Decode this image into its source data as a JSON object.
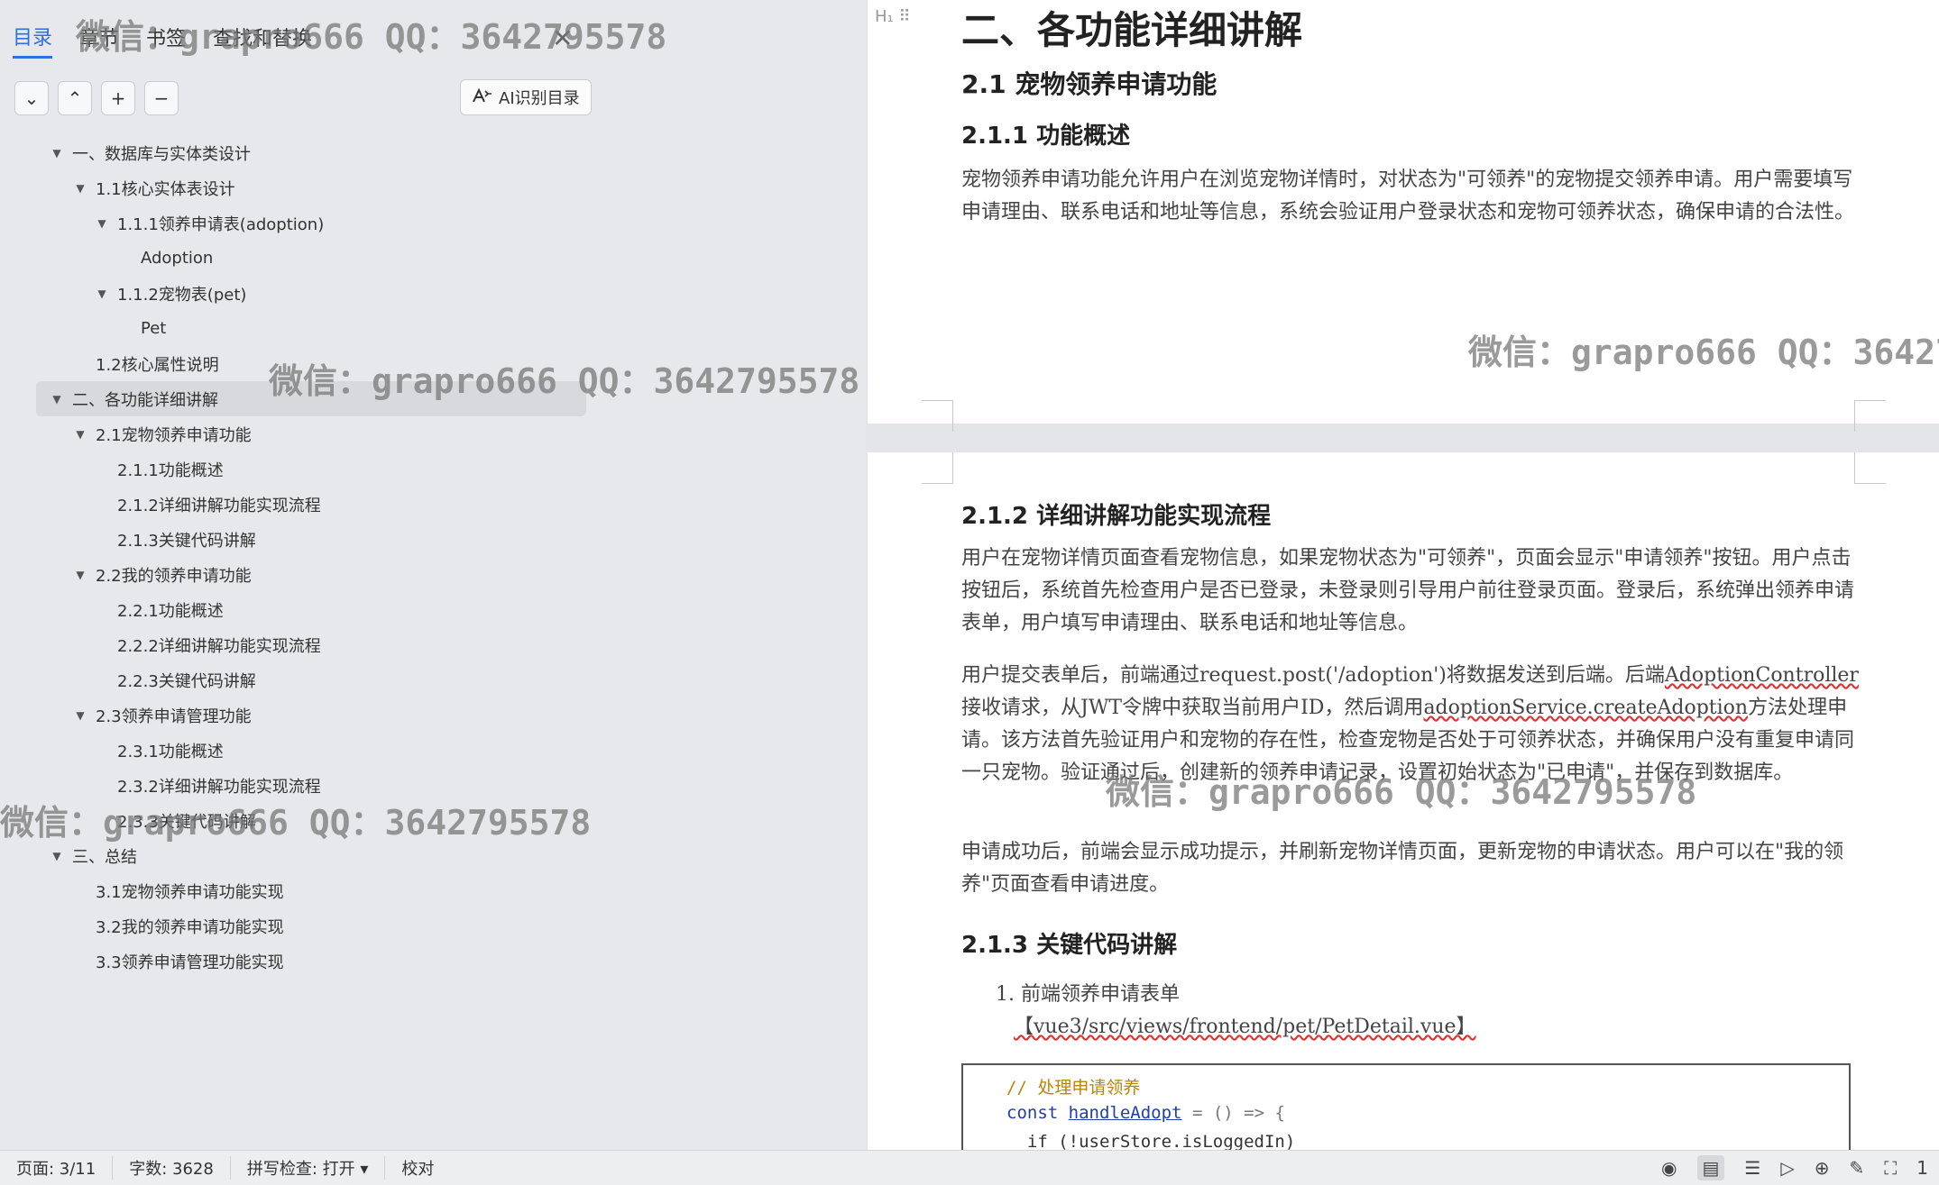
{
  "nav": {
    "tabs": [
      "目录",
      "章节",
      "书签",
      "查找和替换"
    ],
    "tools": [
      "chevron-down-icon",
      "chevron-up-icon",
      "plus-icon",
      "minus-icon"
    ],
    "ai_toc_label": "AI识别目录",
    "toc": [
      {
        "text": "一、数据库与实体类设计",
        "level": 1,
        "expanded": true
      },
      {
        "text": "1.1核心实体表设计",
        "level": 2,
        "expanded": true
      },
      {
        "text": "1.1.1领养申请表(adoption)",
        "level": 3,
        "expanded": true
      },
      {
        "text": "Adoption",
        "level": 4,
        "expanded": null
      },
      {
        "text": "1.1.2宠物表(pet)",
        "level": 3,
        "expanded": true
      },
      {
        "text": "Pet",
        "level": 4,
        "expanded": null
      },
      {
        "text": "1.2核心属性说明",
        "level": 2,
        "expanded": null
      },
      {
        "text": "二、各功能详细讲解",
        "level": 1,
        "expanded": true,
        "selected": true
      },
      {
        "text": "2.1宠物领养申请功能",
        "level": 2,
        "expanded": true
      },
      {
        "text": "2.1.1功能概述",
        "level": 3,
        "expanded": null
      },
      {
        "text": "2.1.2详细讲解功能实现流程",
        "level": 3,
        "expanded": null
      },
      {
        "text": "2.1.3关键代码讲解",
        "level": 3,
        "expanded": null
      },
      {
        "text": "2.2我的领养申请功能",
        "level": 2,
        "expanded": true
      },
      {
        "text": "2.2.1功能概述",
        "level": 3,
        "expanded": null
      },
      {
        "text": "2.2.2详细讲解功能实现流程",
        "level": 3,
        "expanded": null
      },
      {
        "text": "2.2.3关键代码讲解",
        "level": 3,
        "expanded": null
      },
      {
        "text": "2.3领养申请管理功能",
        "level": 2,
        "expanded": true
      },
      {
        "text": "2.3.1功能概述",
        "level": 3,
        "expanded": null
      },
      {
        "text": "2.3.2详细讲解功能实现流程",
        "level": 3,
        "expanded": null
      },
      {
        "text": "2.3.3关键代码讲解",
        "level": 3,
        "expanded": null
      },
      {
        "text": "三、总结",
        "level": 1,
        "expanded": true
      },
      {
        "text": "3.1宠物领养申请功能实现",
        "level": 2,
        "expanded": null
      },
      {
        "text": "3.2我的领养申请功能实现",
        "level": 2,
        "expanded": null
      },
      {
        "text": "3.3领养申请管理功能实现",
        "level": 2,
        "expanded": null
      }
    ]
  },
  "watermark": "微信：grapro666 QQ：3642795578",
  "doc": {
    "page1": {
      "h1": "二、各功能详细讲解",
      "h2": "2.1  宠物领养申请功能",
      "h3": "2.1.1  功能概述",
      "p1": "宠物领养申请功能允许用户在浏览宠物详情时，对状态为\"可领养\"的宠物提交领养申请。用户需要填写申请理由、联系电话和地址等信息，系统会验证用户登录状态和宠物可领养状态，确保申请的合法性。"
    },
    "page2": {
      "h3a": "2.1.2  详细讲解功能实现流程",
      "p1": "用户在宠物详情页面查看宠物信息，如果宠物状态为\"可领养\"，页面会显示\"申请领养\"按钮。用户点击按钮后，系统首先检查用户是否已登录，未登录则引导用户前往登录页面。登录后，系统弹出领养申请表单，用户填写申请理由、联系电话和地址等信息。",
      "p2_a": "用户提交表单后，前端通过request.post('/adoption')将数据发送到后端。后端",
      "p2_b": "AdoptionController",
      "p2_c": "接收请求，从JWT令牌中获取当前用户ID，然后调用",
      "p2_d": "adoptionService.createAdoption",
      "p2_e": "方法处理申请。该方法首先验证用户和宠物的存在性，检查宠物是否处于可领养状态，并确保用户没有重复申请同一只宠物。验证通过后，创建新的领养申请记录，设置初始状态为\"已申请\"，并保存到数据库。",
      "p3": "申请成功后，前端会显示成功提示，并刷新宠物详情页面，更新宠物的申请状态。用户可以在\"我的领养\"页面查看申请进度。",
      "h3b": "2.1.3  关键代码讲解",
      "li1": "1. 前端领养申请表单",
      "li1_path": "【vue3/src/views/frontend/pet/PetDetail.vue】",
      "code": {
        "line1": "// 处理申请领养",
        "line2_kw": "const",
        "line2_fn": "handleAdopt",
        "line2_rest": " = () => {",
        "line3": "  if (!userStore.isLoggedIn)"
      }
    }
  },
  "status": {
    "page": "页面: 3/11",
    "words": "字数: 3628",
    "spell": "拼写检查: 打开",
    "proof": "校对",
    "icons": [
      "eye-icon",
      "page-view-icon",
      "outline-view-icon",
      "play-icon",
      "globe-icon",
      "pen-icon",
      "fit-icon"
    ],
    "zoom_fragment": "1"
  }
}
